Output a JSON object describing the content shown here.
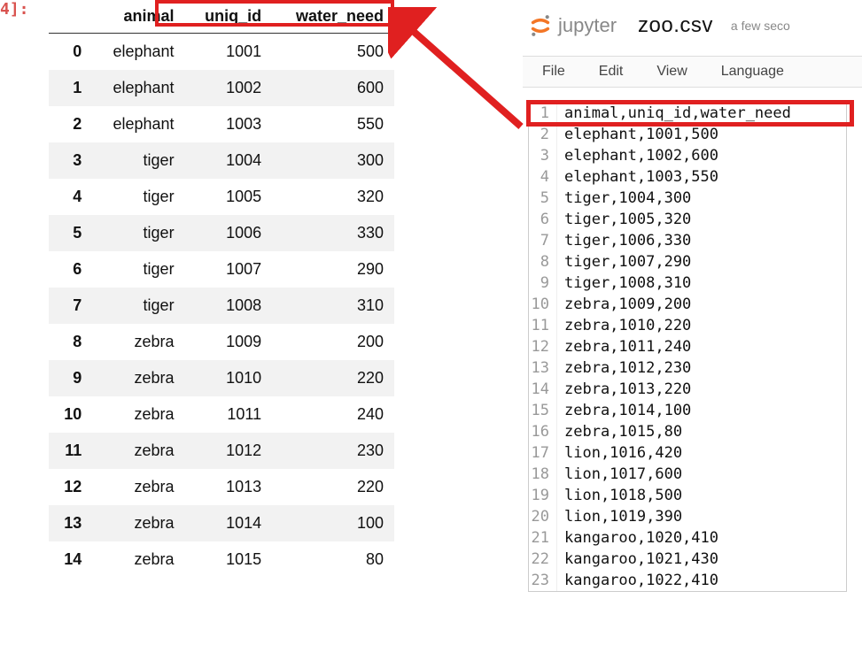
{
  "cell_prompt": "4]:",
  "dataframe": {
    "columns": [
      "animal",
      "uniq_id",
      "water_need"
    ],
    "rows": [
      {
        "idx": "0",
        "animal": "elephant",
        "uniq_id": "1001",
        "water_need": "500"
      },
      {
        "idx": "1",
        "animal": "elephant",
        "uniq_id": "1002",
        "water_need": "600"
      },
      {
        "idx": "2",
        "animal": "elephant",
        "uniq_id": "1003",
        "water_need": "550"
      },
      {
        "idx": "3",
        "animal": "tiger",
        "uniq_id": "1004",
        "water_need": "300"
      },
      {
        "idx": "4",
        "animal": "tiger",
        "uniq_id": "1005",
        "water_need": "320"
      },
      {
        "idx": "5",
        "animal": "tiger",
        "uniq_id": "1006",
        "water_need": "330"
      },
      {
        "idx": "6",
        "animal": "tiger",
        "uniq_id": "1007",
        "water_need": "290"
      },
      {
        "idx": "7",
        "animal": "tiger",
        "uniq_id": "1008",
        "water_need": "310"
      },
      {
        "idx": "8",
        "animal": "zebra",
        "uniq_id": "1009",
        "water_need": "200"
      },
      {
        "idx": "9",
        "animal": "zebra",
        "uniq_id": "1010",
        "water_need": "220"
      },
      {
        "idx": "10",
        "animal": "zebra",
        "uniq_id": "1011",
        "water_need": "240"
      },
      {
        "idx": "11",
        "animal": "zebra",
        "uniq_id": "1012",
        "water_need": "230"
      },
      {
        "idx": "12",
        "animal": "zebra",
        "uniq_id": "1013",
        "water_need": "220"
      },
      {
        "idx": "13",
        "animal": "zebra",
        "uniq_id": "1014",
        "water_need": "100"
      },
      {
        "idx": "14",
        "animal": "zebra",
        "uniq_id": "1015",
        "water_need": "80"
      }
    ]
  },
  "jupyter": {
    "brand": "jupyter",
    "filename": "zoo.csv",
    "saved_ago": "a few seco",
    "menu": {
      "file": "File",
      "edit": "Edit",
      "view": "View",
      "language": "Language"
    }
  },
  "editor_lines": [
    {
      "n": "1",
      "text": "animal,uniq_id,water_need"
    },
    {
      "n": "2",
      "text": "elephant,1001,500"
    },
    {
      "n": "3",
      "text": "elephant,1002,600"
    },
    {
      "n": "4",
      "text": "elephant,1003,550"
    },
    {
      "n": "5",
      "text": "tiger,1004,300"
    },
    {
      "n": "6",
      "text": "tiger,1005,320"
    },
    {
      "n": "7",
      "text": "tiger,1006,330"
    },
    {
      "n": "8",
      "text": "tiger,1007,290"
    },
    {
      "n": "9",
      "text": "tiger,1008,310"
    },
    {
      "n": "10",
      "text": "zebra,1009,200"
    },
    {
      "n": "11",
      "text": "zebra,1010,220"
    },
    {
      "n": "12",
      "text": "zebra,1011,240"
    },
    {
      "n": "13",
      "text": "zebra,1012,230"
    },
    {
      "n": "14",
      "text": "zebra,1013,220"
    },
    {
      "n": "15",
      "text": "zebra,1014,100"
    },
    {
      "n": "16",
      "text": "zebra,1015,80"
    },
    {
      "n": "17",
      "text": "lion,1016,420"
    },
    {
      "n": "18",
      "text": "lion,1017,600"
    },
    {
      "n": "19",
      "text": "lion,1018,500"
    },
    {
      "n": "20",
      "text": "lion,1019,390"
    },
    {
      "n": "21",
      "text": "kangaroo,1020,410"
    },
    {
      "n": "22",
      "text": "kangaroo,1021,430"
    },
    {
      "n": "23",
      "text": "kangaroo,1022,410"
    }
  ]
}
